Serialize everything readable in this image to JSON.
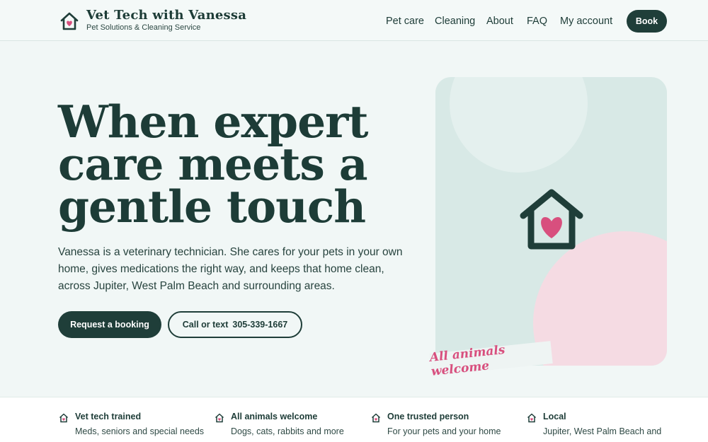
{
  "brand": {
    "name": "Vet Tech with Vanessa",
    "tagline": "Pet Solutions & Cleaning Service",
    "logo_icon": "house-heart-icon"
  },
  "nav": {
    "items": [
      {
        "label": "Pet care"
      },
      {
        "label": "Cleaning"
      },
      {
        "label": "About"
      },
      {
        "label": "FAQ"
      },
      {
        "label": "My account"
      }
    ],
    "book_label": "Book"
  },
  "hero": {
    "title_lines": [
      "When expert",
      "care meets a",
      "gentle touch"
    ],
    "description": "Vanessa is a veterinary technician. She cares for your pets in your own home, gives medications the right way, and keeps that home clean, across Jupiter, West Palm Beach and surrounding areas.",
    "primary_cta": "Request a booking",
    "secondary_cta_prefix": "Call or text",
    "phone": "305-339-1667"
  },
  "illustration": {
    "icon": "house-heart-icon",
    "sticker_text": "All animals welcome"
  },
  "features": [
    {
      "icon": "house-heart-icon",
      "title": "Vet tech trained",
      "desc": "Meds, seniors and special needs"
    },
    {
      "icon": "house-heart-icon",
      "title": "All animals welcome",
      "desc": "Dogs, cats, rabbits and more"
    },
    {
      "icon": "house-heart-icon",
      "title": "One trusted person",
      "desc": "For your pets and your home"
    },
    {
      "icon": "house-heart-icon",
      "title": "Local",
      "desc": "Jupiter, West Palm Beach and"
    }
  ],
  "colors": {
    "brand_dark": "#1f3e39",
    "accent_pink": "#d84f7e",
    "background": "#f1f7f6"
  }
}
